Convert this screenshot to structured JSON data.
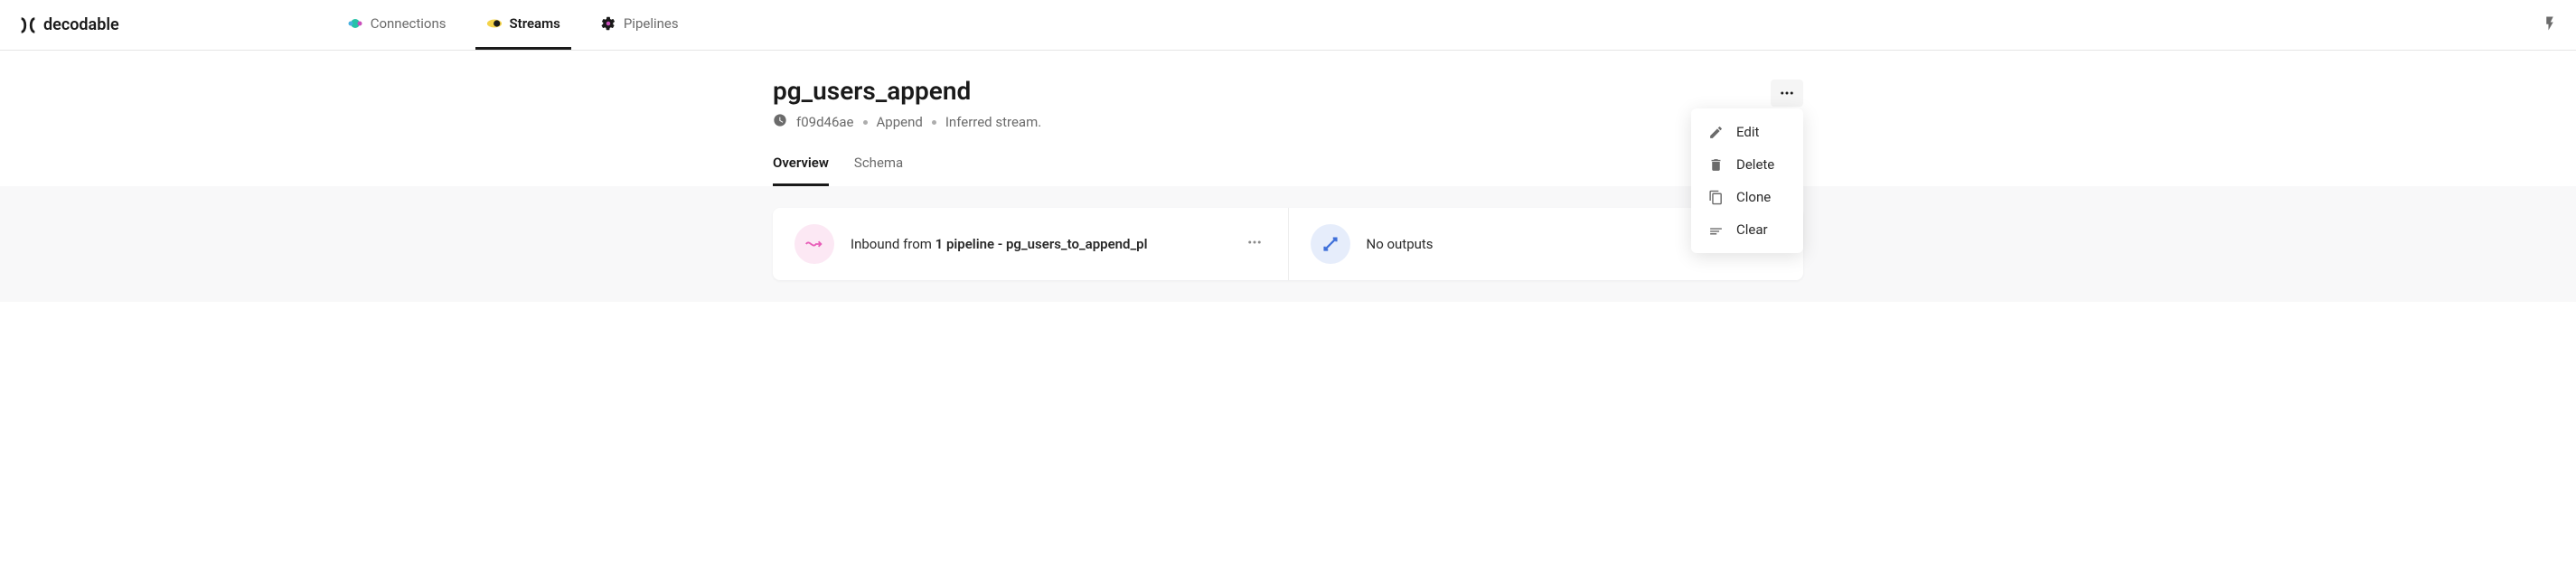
{
  "brand": "decodable",
  "nav": {
    "items": [
      {
        "label": "Connections"
      },
      {
        "label": "Streams"
      },
      {
        "label": "Pipelines"
      }
    ]
  },
  "page": {
    "title": "pg_users_append",
    "meta": {
      "id": "f09d46ae",
      "type": "Append",
      "description": "Inferred stream."
    }
  },
  "subtabs": {
    "items": [
      {
        "label": "Overview"
      },
      {
        "label": "Schema"
      }
    ]
  },
  "panels": {
    "inbound": {
      "prefix": "Inbound from ",
      "bold": "1 pipeline - pg_users_to_append_pl"
    },
    "outbound": {
      "text": "No outputs"
    }
  },
  "menu": {
    "items": [
      {
        "label": "Edit"
      },
      {
        "label": "Delete"
      },
      {
        "label": "Clone"
      },
      {
        "label": "Clear"
      }
    ]
  }
}
